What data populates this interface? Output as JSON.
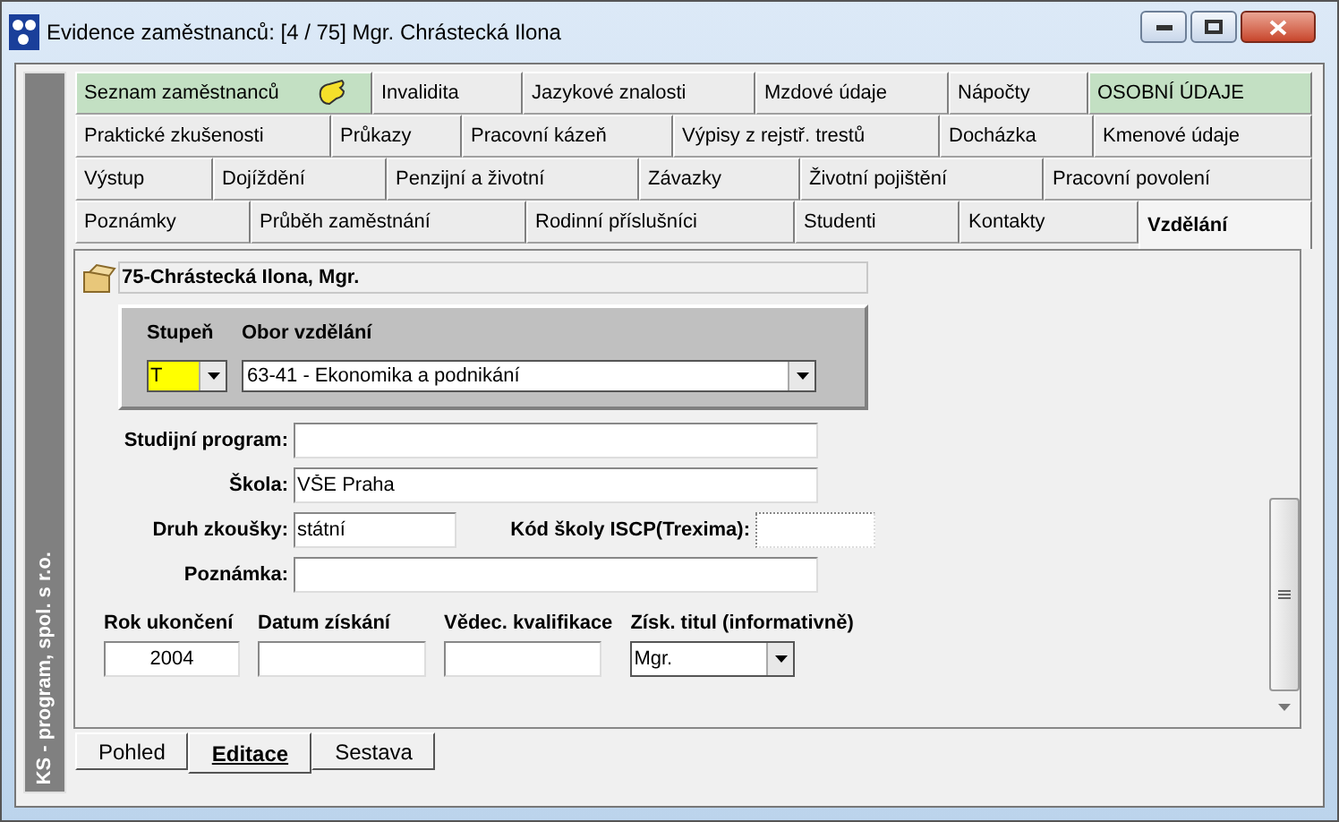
{
  "window": {
    "title": "Evidence zaměstnanců: [4 / 75] Mgr. Chrástecká Ilona"
  },
  "side_label": "KS - program, spol. s r.o.",
  "tab_rows": [
    {
      "tabs": [
        {
          "label": "Seznam zaměstnanců",
          "selected": false,
          "highlighted": true,
          "kind": "icon"
        },
        {
          "label": "Invalidita",
          "selected": false,
          "highlighted": false
        },
        {
          "label": "Jazykové znalosti",
          "selected": false,
          "highlighted": false
        },
        {
          "label": "Mzdové údaje",
          "selected": false,
          "highlighted": false
        },
        {
          "label": "Nápočty",
          "selected": false,
          "highlighted": false
        },
        {
          "label": "OSOBNÍ ÚDAJE",
          "selected": false,
          "highlighted": true
        }
      ]
    },
    {
      "tabs": [
        {
          "label": "Praktické zkušenosti",
          "selected": false,
          "highlighted": false
        },
        {
          "label": "Průkazy",
          "selected": false,
          "highlighted": false
        },
        {
          "label": "Pracovní kázeň",
          "selected": false,
          "highlighted": false
        },
        {
          "label": "Výpisy z rejstř. trestů",
          "selected": false,
          "highlighted": false
        },
        {
          "label": "Docházka",
          "selected": false,
          "highlighted": false
        },
        {
          "label": "Kmenové údaje",
          "selected": false,
          "highlighted": false
        }
      ]
    },
    {
      "tabs": [
        {
          "label": "Výstup",
          "selected": false,
          "highlighted": false
        },
        {
          "label": "Dojíždění",
          "selected": false,
          "highlighted": false
        },
        {
          "label": "Penzijní a životní",
          "selected": false,
          "highlighted": false
        },
        {
          "label": "Závazky",
          "selected": false,
          "highlighted": false
        },
        {
          "label": "Životní pojištění",
          "selected": false,
          "highlighted": false
        },
        {
          "label": "Pracovní povolení",
          "selected": false,
          "highlighted": false
        }
      ]
    },
    {
      "tabs": [
        {
          "label": "Poznámky",
          "selected": false,
          "highlighted": false
        },
        {
          "label": "Průběh zaměstnání",
          "selected": false,
          "highlighted": false
        },
        {
          "label": "Rodinní příslušníci",
          "selected": false,
          "highlighted": false
        },
        {
          "label": "Studenti",
          "selected": false,
          "highlighted": false
        },
        {
          "label": "Kontakty",
          "selected": false,
          "highlighted": false
        },
        {
          "label": "Vzdělání",
          "selected": true,
          "highlighted": false
        }
      ]
    }
  ],
  "record": {
    "title": "75-Chrástecká Ilona, Mgr."
  },
  "degree": {
    "label": "Stupeň",
    "value": "T"
  },
  "field_of_study": {
    "label": "Obor vzdělání",
    "value": "63-41 - Ekonomika a podnikání"
  },
  "study_program": {
    "label": "Studijní program:"
  },
  "school": {
    "label": "Škola:",
    "value": "VŠE Praha"
  },
  "exam_type": {
    "label": "Druh zkoušky:",
    "value": "státní"
  },
  "school_code": {
    "label": "Kód školy ISCP(Trexima):"
  },
  "note": {
    "label": "Poznámka:"
  },
  "year_finished": {
    "label": "Rok ukončení",
    "value": "2004"
  },
  "date_obtained": {
    "label": "Datum získání"
  },
  "scientific_qualification": {
    "label": "Vědec. kvalifikace"
  },
  "title_obtained": {
    "label": "Získ. titul (informativně)",
    "value": "Mgr."
  },
  "bottom_tabs": [
    {
      "label": "Pohled",
      "selected": false
    },
    {
      "label": "Editace",
      "selected": true
    },
    {
      "label": "Sestava",
      "selected": false
    }
  ]
}
